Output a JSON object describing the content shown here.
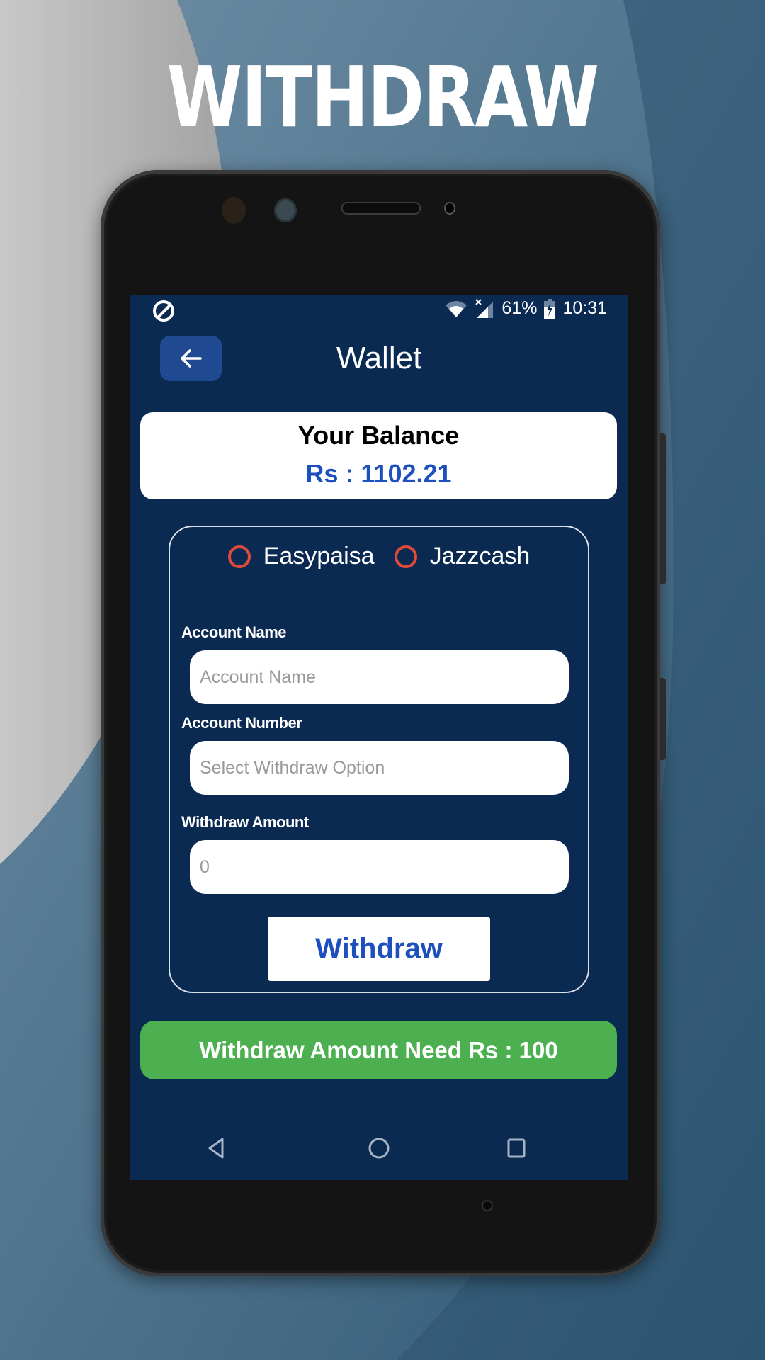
{
  "promo": {
    "title": "WITHDRAW"
  },
  "status_bar": {
    "dnd_icon": "do-not-disturb-icon",
    "wifi_icon": "wifi-icon",
    "signal_icon": "signal-no-data-icon",
    "battery_percent": "61%",
    "battery_icon": "battery-charging-icon",
    "time": "10:31"
  },
  "header": {
    "back_icon": "arrow-left-icon",
    "title": "Wallet"
  },
  "balance": {
    "label": "Your Balance",
    "value": "Rs : 1102.21"
  },
  "form": {
    "payment_methods": [
      {
        "label": "Easypaisa",
        "selected": false
      },
      {
        "label": "Jazzcash",
        "selected": false
      }
    ],
    "fields": [
      {
        "label": "Account Name",
        "placeholder": "Account Name",
        "value": ""
      },
      {
        "label": "Account Number",
        "placeholder": "Select Withdraw Option",
        "value": ""
      },
      {
        "label": "Withdraw Amount",
        "placeholder": "0",
        "value": ""
      }
    ],
    "submit_label": "Withdraw"
  },
  "notice": {
    "text": "Withdraw Amount Need Rs : 100"
  },
  "nav": {
    "back": "nav-back-icon",
    "home": "nav-home-icon",
    "recents": "nav-recents-icon"
  },
  "colors": {
    "screen_bg": "#0b2a52",
    "accent_blue": "#1d4fbf",
    "back_button": "#1f4a92",
    "radio": "#e04a3c",
    "notice_green": "#4caf50"
  }
}
